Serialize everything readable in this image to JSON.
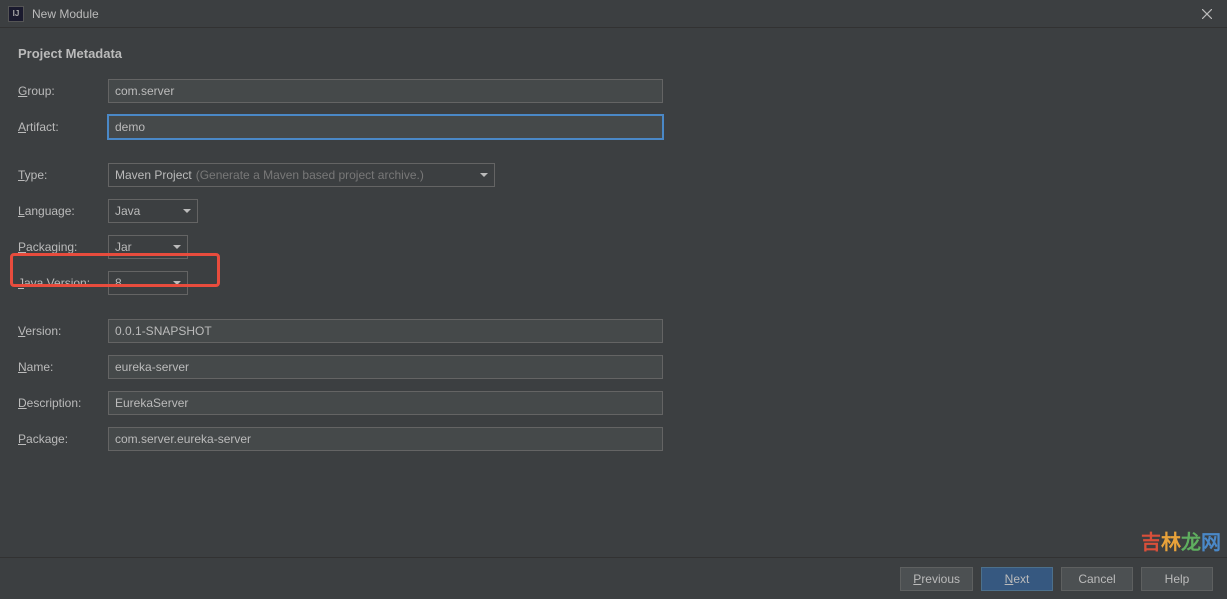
{
  "window": {
    "title": "New Module"
  },
  "section": {
    "title": "Project Metadata"
  },
  "labels": {
    "group": "roup:",
    "artifact": "rtifact:",
    "type": "ype:",
    "language": "anguage:",
    "packaging": "ackaging:",
    "javaVersion": "ava Version:",
    "version": "ersion:",
    "name": "ame:",
    "description": "escription:",
    "package": "ackage:"
  },
  "fields": {
    "group": "com.server",
    "artifact": "demo",
    "type": "Maven Project",
    "typeHint": "(Generate a Maven based project archive.)",
    "language": "Java",
    "packaging": "Jar",
    "javaVersion": "8",
    "version": "0.0.1-SNAPSHOT",
    "name": "eureka-server",
    "description": "EurekaServer",
    "package": "com.server.eureka-server"
  },
  "buttons": {
    "previous": "revious",
    "next": "ext",
    "cancel": "Cancel",
    "help": "Help"
  },
  "watermark": "吉林龙网"
}
